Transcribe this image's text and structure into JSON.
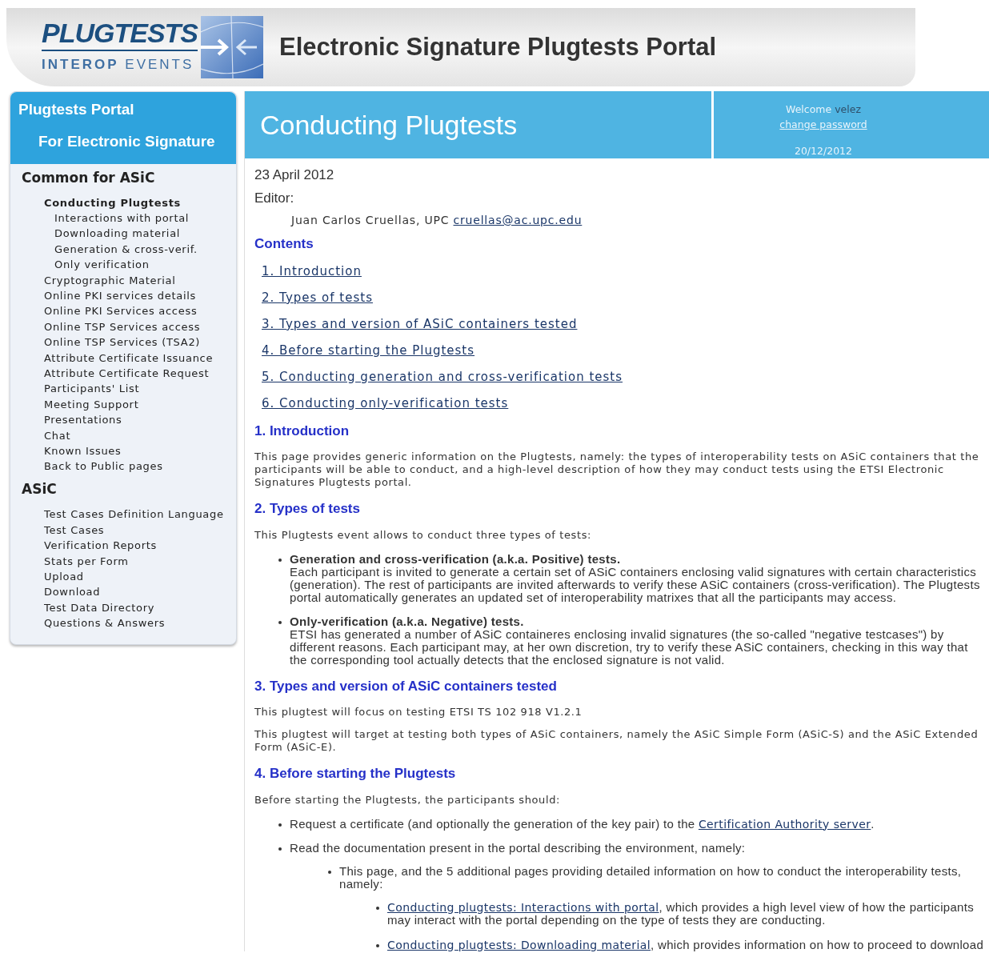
{
  "header": {
    "logo": {
      "wordmark": "PLUGTESTS",
      "tagline_bold": "INTEROP",
      "tagline": "EVENTS"
    },
    "title": "Electronic Signature Plugtests Portal"
  },
  "sidebar": {
    "title_line_1": "Plugtests Portal",
    "title_line_2": "For Electronic Signature",
    "sections": [
      {
        "heading": "Common for ASiC",
        "items": [
          {
            "label": "Conducting Plugtests",
            "selected": true,
            "children": [
              {
                "label": "Interactions with portal",
                "selected": false
              },
              {
                "label": "Downloading material",
                "selected": false
              },
              {
                "label": "Generation & cross-verif.",
                "selected": false
              },
              {
                "label": "Only verification",
                "selected": false
              }
            ]
          },
          {
            "label": "Cryptographic Material",
            "selected": false
          },
          {
            "label": "Online PKI services details",
            "selected": false
          },
          {
            "label": "Online PKI Services access",
            "selected": false
          },
          {
            "label": "Online TSP Services access",
            "selected": false
          },
          {
            "label": "Online TSP Services (TSA2)",
            "selected": false
          },
          {
            "label": "Attribute Certificate Issuance",
            "selected": false
          },
          {
            "label": "Attribute Certificate Request",
            "selected": false
          },
          {
            "label": "Participants' List",
            "selected": false
          },
          {
            "label": "Meeting Support",
            "selected": false
          },
          {
            "label": "Presentations",
            "selected": false
          },
          {
            "label": "Chat",
            "selected": false
          },
          {
            "label": "Known Issues",
            "selected": false
          },
          {
            "label": "Back to Public pages",
            "selected": false
          }
        ]
      },
      {
        "heading": "ASiC",
        "items": [
          {
            "label": "Test Cases Definition Language",
            "selected": false
          },
          {
            "label": "Test Cases",
            "selected": false
          },
          {
            "label": "Verification Reports",
            "selected": false
          },
          {
            "label": "Stats per Form",
            "selected": false
          },
          {
            "label": "Upload",
            "selected": false
          },
          {
            "label": "Download",
            "selected": false
          },
          {
            "label": "Test Data Directory",
            "selected": false
          },
          {
            "label": "Questions & Answers",
            "selected": false
          }
        ]
      }
    ]
  },
  "main": {
    "title": "Conducting Plugtests",
    "welcome": "Welcome",
    "user": "velez",
    "change_password": "change password",
    "date": "20/12/2012",
    "doc_date": "23 April 2012",
    "editor_label": "Editor:",
    "editor_name": "Juan Carlos Cruellas, UPC ",
    "editor_email": "cruellas@ac.upc.edu",
    "contents_heading": "Contents",
    "contents": [
      "1. Introduction",
      "2. Types of tests",
      "3. Types and version of ASiC containers tested",
      "4. Before starting the Plugtests",
      "5. Conducting generation and cross-verification tests",
      "6. Conducting only-verification tests"
    ],
    "sections": [
      {
        "heading": "1. Introduction",
        "blocks": [
          {
            "kind": "paragraph",
            "text": "This page provides generic information on the Plugtests, namely: the types of interoperability tests on ASiC containers that the participants will be able to conduct, and a high-level description of how they may conduct tests using the ETSI Electronic Signatures Plugtests portal."
          }
        ]
      },
      {
        "heading": "2. Types of tests",
        "blocks": [
          {
            "kind": "paragraph",
            "text": "This Plugtests event allows to conduct three types of tests:"
          },
          {
            "kind": "definitions",
            "items": [
              {
                "title": "Generation and cross-verification (a.k.a. Positive) tests.",
                "text": "Each participant is invited to generate a certain set of ASiC containers enclosing valid signatures with certain characteristics (generation). The rest of participants are invited afterwards to verify these ASiC containers (cross-verification). The Plugtests portal automatically generates an updated set of interoperability matrixes that all the participants may access."
              },
              {
                "title": "Only-verification (a.k.a. Negative) tests.",
                "text": "ETSI has generated a number of ASiC containeres enclosing invalid signatures (the so-called \"negative testcases\") by different reasons. Each participant may, at her own discretion, try to verify these ASiC containers, checking in this way that the corresponding tool actually detects that the enclosed signature is not valid."
              }
            ]
          }
        ]
      },
      {
        "heading": "3. Types and version of ASiC containers tested",
        "blocks": [
          {
            "kind": "paragraph",
            "text": "This plugtest will focus on testing ETSI TS 102 918 V1.2.1"
          },
          {
            "kind": "paragraph",
            "text": "This plugtest will target at testing both types of ASiC containers, namely the ASiC Simple Form (ASiC-S) and the ASiC Extended Form (ASiC-E)."
          }
        ]
      },
      {
        "heading": "4. Before starting the Plugtests",
        "blocks": [
          {
            "kind": "paragraph",
            "text": "Before starting the Plugtests, the participants should:"
          },
          {
            "kind": "bullets",
            "items": [
              {
                "text": "Request a certificate (and optionally the generation of the key pair) to the ",
                "link": "Certification Authority server",
                "after": "."
              },
              {
                "text": "Read the documentation present in the portal describing the environment, namely:",
                "children": [
                  {
                    "text": "This page, and the 5 additional pages providing detailed information on how to conduct the interoperability tests, namely:",
                    "children": [
                      {
                        "link": "Conducting plugtests: Interactions with portal",
                        "after": ", which provides a high level view of how the participants may interact with the portal depending on the type of tests they are conducting."
                      },
                      {
                        "link": "Conducting plugtests: Downloading material",
                        "after": ", which provides information on how to proceed to download"
                      }
                    ]
                  }
                ]
              }
            ]
          }
        ]
      }
    ]
  }
}
